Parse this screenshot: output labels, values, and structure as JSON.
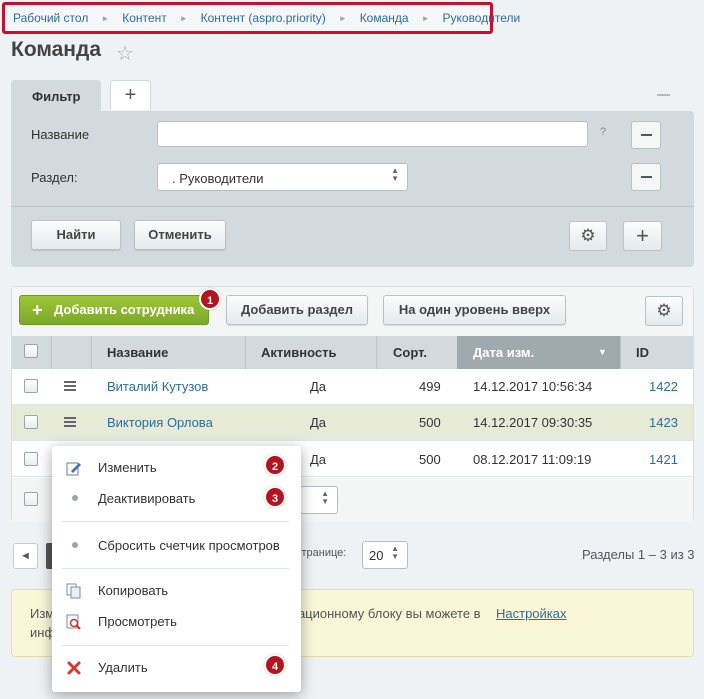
{
  "breadcrumb": [
    "Рабочий стол",
    "Контент",
    "Контент (aspro.priority)",
    "Команда",
    "Руководители"
  ],
  "page_title": "Команда",
  "filter": {
    "tab_label": "Фильтр",
    "add_tab": "+",
    "name_label": "Название",
    "name_value": "",
    "help": "?",
    "section_label": "Раздел:",
    "section_value": ". Руководители",
    "find_button": "Найти",
    "cancel_button": "Отменить"
  },
  "toolbar": {
    "add_employee": "Добавить сотрудника",
    "add_section": "Добавить раздел",
    "level_up": "На один уровень вверх"
  },
  "table": {
    "columns": [
      "Название",
      "Активность",
      "Сорт.",
      "Дата изм.",
      "ID"
    ],
    "rows": [
      {
        "name": "Виталий Кутузов",
        "active": "Да",
        "sort": "499",
        "date": "14.12.2017 10:56:34",
        "id": "1422"
      },
      {
        "name": "Виктория Орлова",
        "active": "Да",
        "sort": "500",
        "date": "14.12.2017 09:30:35",
        "id": "1423"
      },
      {
        "name": "",
        "active": "Да",
        "sort": "500",
        "date": "08.12.2017 11:09:19",
        "id": "1421"
      }
    ]
  },
  "pager": {
    "per_page_label": "странице:",
    "per_page_value": "20",
    "summary": "Разделы 1 – 3 из 3"
  },
  "notice": {
    "left_fragment_1": "Изм",
    "left_fragment_2": "инф",
    "middle_text": "мационному блоку вы можете в",
    "link_text": "Настройках"
  },
  "context_menu": {
    "edit": "Изменить",
    "deactivate": "Деактивировать",
    "reset_views": "Сбросить счетчик просмотров",
    "copy": "Копировать",
    "view": "Просмотреть",
    "delete": "Удалить"
  },
  "badges": [
    "1",
    "2",
    "3",
    "4"
  ],
  "colors": {
    "highlight_border": "#c8102e",
    "badge": "#b3141f",
    "primary_button": "#8cb832",
    "link": "#2d6e9a",
    "selected_row": "#e6ead7",
    "notice_bg": "#f9f7d8"
  }
}
